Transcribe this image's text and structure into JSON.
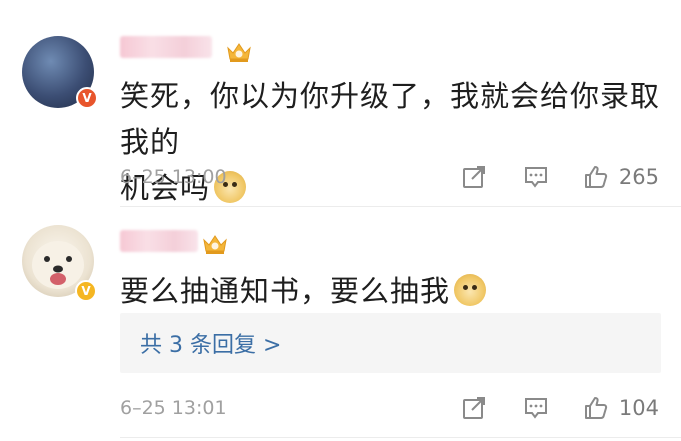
{
  "comments": [
    {
      "text_line1": "笑死，你以为你升级了，我就会给你录取我的",
      "text_line2": "机会吗",
      "time": "6–25 13:00",
      "likes": "265",
      "badge_letter": "V"
    },
    {
      "text": "要么抽通知书，要么抽我",
      "replies_label": "共 3 条回复 >",
      "time": "6–25 13:01",
      "likes": "104",
      "badge_letter": "V"
    }
  ],
  "colors": {
    "accent_link": "#3b6ea5",
    "vip_orange": "#e8552c",
    "vip_gold": "#f5b622",
    "meta_gray": "#a0a0a0"
  },
  "icons": {
    "share": "share-icon",
    "comment": "comment-icon",
    "like": "thumbs-up-icon",
    "crown": "crown-badge-icon",
    "emoji": "doge-emoji-icon"
  }
}
